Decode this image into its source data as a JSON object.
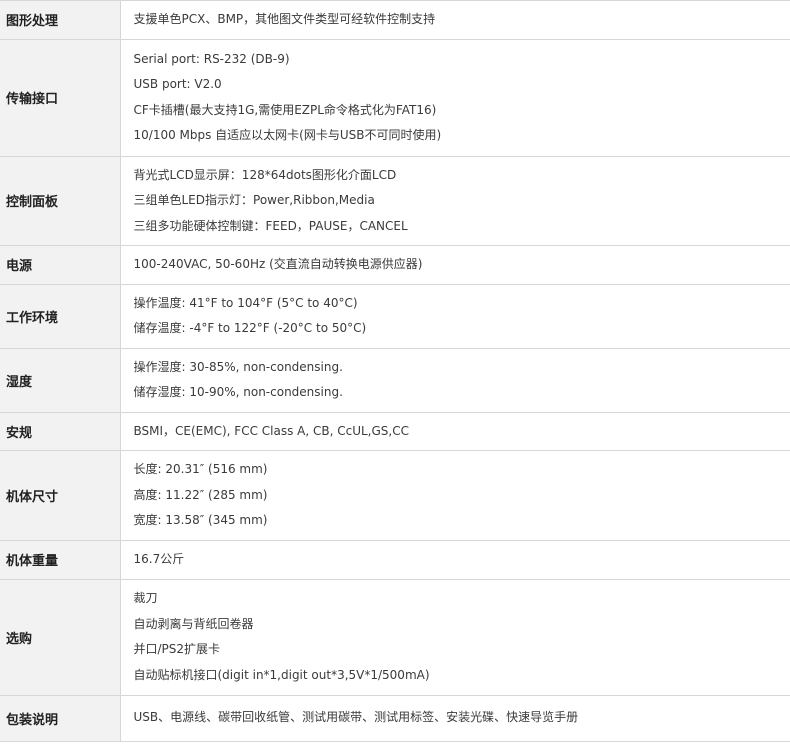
{
  "specs": [
    {
      "label": "图形处理",
      "lines": [
        "支援单色PCX、BMP，其他图文件类型可经软件控制支持"
      ]
    },
    {
      "label": "传输接口",
      "lines": [
        "Serial port: RS-232 (DB-9)",
        "USB port: V2.0",
        "CF卡插槽(最大支持1G,需使用EZPL命令格式化为FAT16)",
        "10/100 Mbps 自适应以太网卡(网卡与USB不可同时使用)"
      ]
    },
    {
      "label": "控制面板",
      "lines": [
        "背光式LCD显示屏：128*64dots图形化介面LCD",
        "三组单色LED指示灯：Power,Ribbon,Media",
        "三组多功能硬体控制键：FEED，PAUSE，CANCEL"
      ]
    },
    {
      "label": "电源",
      "lines": [
        "100-240VAC, 50-60Hz (交直流自动转换电源供应器)"
      ]
    },
    {
      "label": "工作环境",
      "lines": [
        "操作温度: 41°F to 104°F (5°C to 40°C)",
        "储存温度: -4°F to 122°F (-20°C to 50°C)"
      ]
    },
    {
      "label": "湿度",
      "lines": [
        "操作湿度: 30-85%, non-condensing.",
        "储存湿度: 10-90%, non-condensing."
      ]
    },
    {
      "label": "安规",
      "lines": [
        "BSMI，CE(EMC), FCC Class A, CB, CcUL,GS,CC"
      ]
    },
    {
      "label": "机体尺寸",
      "lines": [
        "长度: 20.31″ (516 mm)",
        "高度: 11.22″ (285 mm)",
        "宽度: 13.58″ (345 mm)"
      ]
    },
    {
      "label": "机体重量",
      "lines": [
        "16.7公斤"
      ]
    },
    {
      "label": "选购",
      "lines": [
        "裁刀",
        "自动剥离与背纸回卷器",
        "并口/PS2扩展卡",
        "自动贴标机接口(digit in*1,digit out*3,5V*1/500mA)"
      ]
    },
    {
      "label": "包装说明",
      "lines": [
        "USB、电源线、碳带回收纸管、测试用碳带、测试用标签、安装光碟、快速导览手册"
      ]
    }
  ]
}
